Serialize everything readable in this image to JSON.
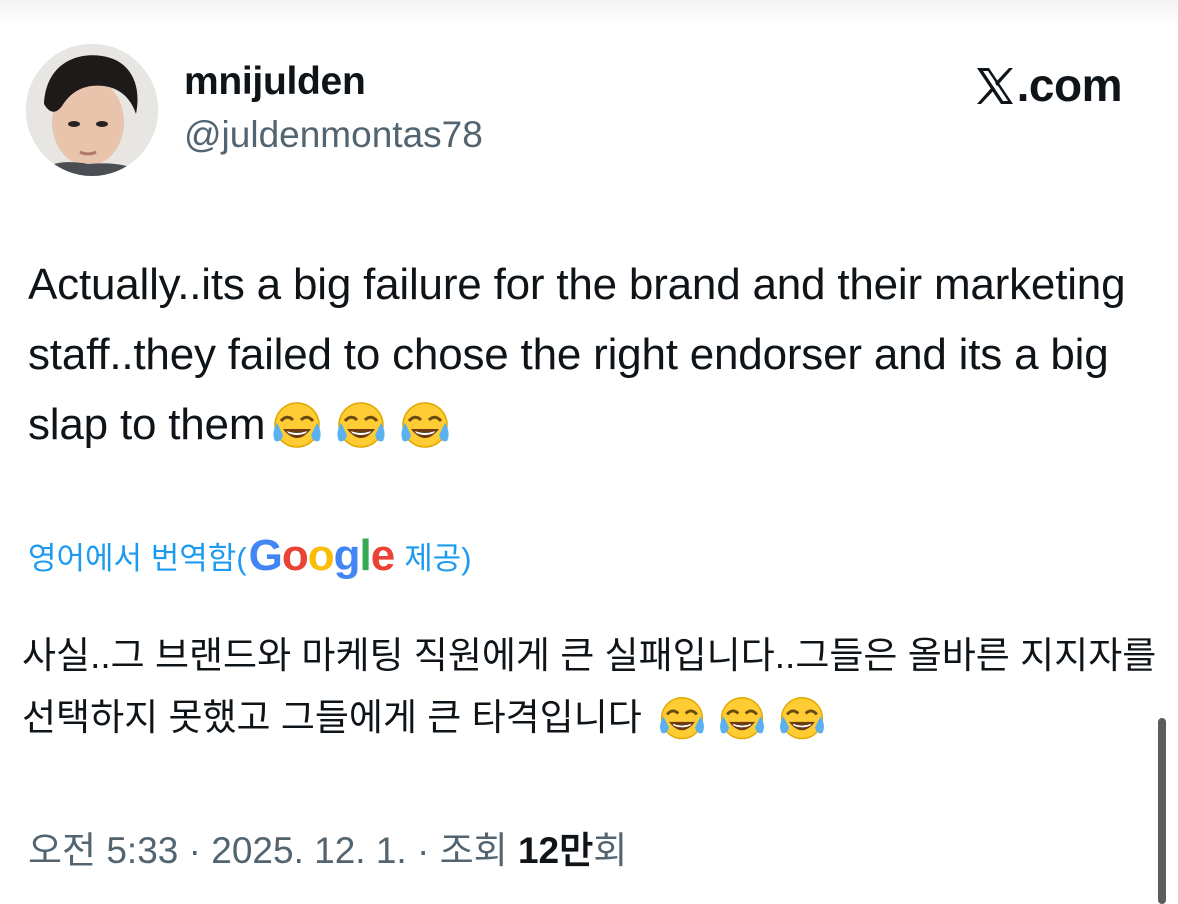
{
  "author": {
    "display_name": "mnijulden",
    "handle": "@juldenmontas78"
  },
  "brand": {
    "label": ".com",
    "icon": "x-logo-icon"
  },
  "tweet": {
    "text": "Actually..its a big failure for the brand and their marketing staff..they failed to chose the right endorser and its a big slap to them",
    "emoji_name": "face-with-tears-of-joy-icon"
  },
  "translation": {
    "prefix": "영어에서 번역함(",
    "provider_logo": "Google",
    "suffix": " 제공)",
    "text": "사실..그 브랜드와 마케팅 직원에게 큰 실패입니다..그들은 올바른 지지자를 선택하지 못했고 그들에게 큰 타격입니다 "
  },
  "meta": {
    "time": "오전 5:33",
    "separator": " · ",
    "date": "2025. 12. 1.",
    "views_label": "조회 ",
    "views_count": "12만",
    "views_suffix": "회"
  },
  "colors": {
    "link": "#1d9bf0",
    "secondary_text": "#536471",
    "primary_text": "#0f1419"
  }
}
